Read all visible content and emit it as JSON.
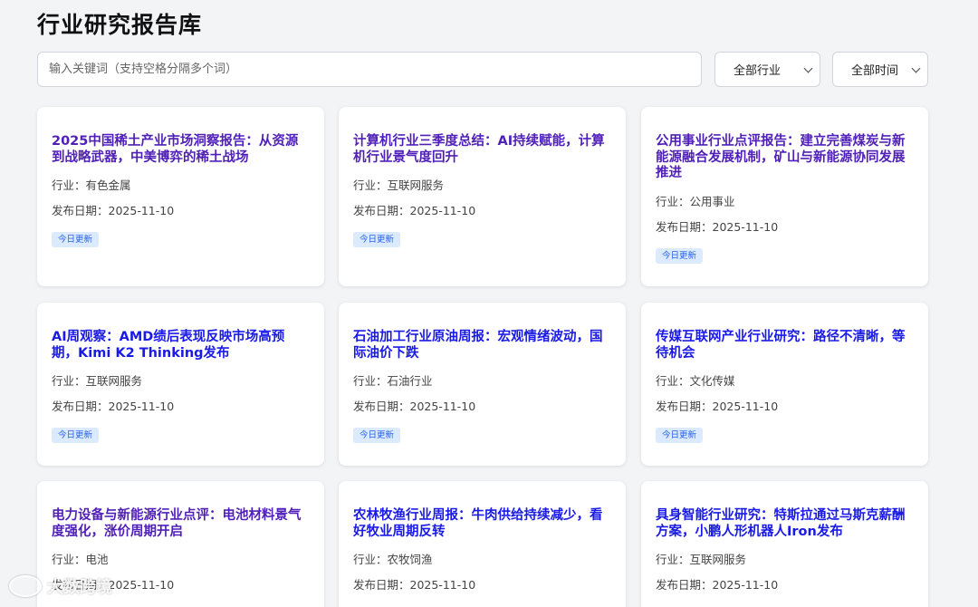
{
  "page": {
    "title": "行业研究报告库"
  },
  "search": {
    "placeholder": "输入关键词（支持空格分隔多个词）"
  },
  "filters": {
    "industry": "全部行业",
    "time": "全部时间"
  },
  "labels": {
    "industry_prefix": "行业：",
    "date_prefix": "发布日期："
  },
  "cards": [
    {
      "title": "2025中国稀土产业市场洞察报告：从资源到战略武器，中美博弈的稀土战场",
      "industry": "有色金属",
      "date": "2025-11-10",
      "badge": "今日更新"
    },
    {
      "title": "计算机行业三季度总结：AI持续赋能，计算机行业景气度回升",
      "industry": "互联网服务",
      "date": "2025-11-10",
      "badge": "今日更新"
    },
    {
      "title": "公用事业行业点评报告：建立完善煤炭与新能源融合发展机制，矿山与新能源协同发展推进",
      "industry": "公用事业",
      "date": "2025-11-10",
      "badge": "今日更新"
    },
    {
      "title": "AI周观察：AMD绩后表现反映市场高预期，Kimi K2 Thinking发布",
      "industry": "互联网服务",
      "date": "2025-11-10",
      "badge": "今日更新"
    },
    {
      "title": "石油加工行业原油周报：宏观情绪波动，国际油价下跌",
      "industry": "石油行业",
      "date": "2025-11-10",
      "badge": "今日更新"
    },
    {
      "title": "传媒互联网产业行业研究：路径不清晰，等待机会",
      "industry": "文化传媒",
      "date": "2025-11-10",
      "badge": "今日更新"
    },
    {
      "title": "电力设备与新能源行业点评：电池材料景气度强化，涨价周期开启",
      "industry": "电池",
      "date": "2025-11-10",
      "badge": ""
    },
    {
      "title": "农林牧渔行业周报：牛肉供给持续减少，看好牧业周期反转",
      "industry": "农牧饲渔",
      "date": "2025-11-10",
      "badge": ""
    },
    {
      "title": "具身智能行业研究：特斯拉通过马斯克薪酬方案，小鹏人形机器人Iron发布",
      "industry": "互联网服务",
      "date": "2025-11-10",
      "badge": ""
    }
  ],
  "watermark": {
    "text": "大数跨境"
  }
}
